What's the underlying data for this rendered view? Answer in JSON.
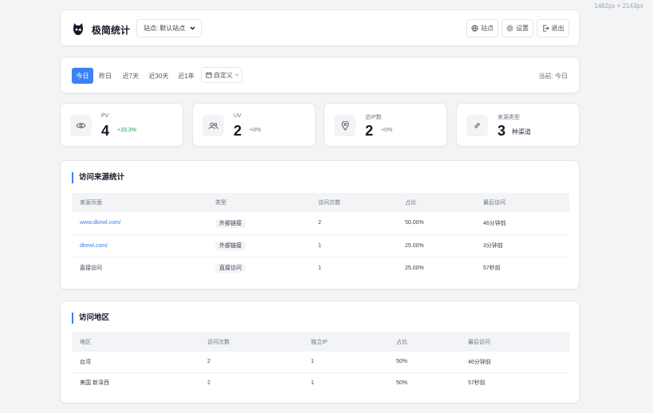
{
  "corner_label": "1462px × 2143px",
  "header": {
    "title": "极简统计",
    "site_label": "站点:",
    "site_value": "默认站点",
    "btn_site": "站点",
    "btn_settings": "设置",
    "btn_logout": "退出"
  },
  "filter": {
    "tabs": [
      "今日",
      "昨日",
      "近7天",
      "近30天",
      "近1年"
    ],
    "custom": "自定义",
    "current": "当前: 今日"
  },
  "stats": [
    {
      "icon": "eye-icon",
      "label": "PV",
      "value": "4",
      "change": "+33.3%"
    },
    {
      "icon": "users-icon",
      "label": "UV",
      "value": "2",
      "change": "+0%"
    },
    {
      "icon": "location-pin-icon",
      "label": "总IP数",
      "value": "2",
      "change": "+0%"
    },
    {
      "icon": "link-icon",
      "label": "来源类型",
      "value": "3",
      "sub": "种渠道"
    }
  ],
  "sources": {
    "title": "访问来源统计",
    "columns": [
      "来源页面",
      "类型",
      "访问次数",
      "占比",
      "最后访问"
    ],
    "rows": [
      {
        "page": "www.dkewl.com/",
        "type": "外部链接",
        "count": "2",
        "ratio": "50.00%",
        "last": "46分钟前"
      },
      {
        "page": "dkewl.com/",
        "type": "外部链接",
        "count": "1",
        "ratio": "25.00%",
        "last": "3分钟前"
      },
      {
        "page": "直接访问",
        "type": "直接访问",
        "count": "1",
        "ratio": "25.00%",
        "last": "57秒前"
      }
    ]
  },
  "regions": {
    "title": "访问地区",
    "columns": [
      "地区",
      "访问次数",
      "独立IP",
      "占比",
      "最后访问"
    ],
    "rows": [
      {
        "region": "台湾",
        "count": "2",
        "ip": "1",
        "ratio": "50%",
        "last": "46分钟前"
      },
      {
        "region": "美国 新泽西",
        "count": "2",
        "ip": "1",
        "ratio": "50%",
        "last": "57秒前"
      }
    ]
  },
  "colors": {
    "accent": "#3b82f6",
    "positive": "#16a34a"
  }
}
